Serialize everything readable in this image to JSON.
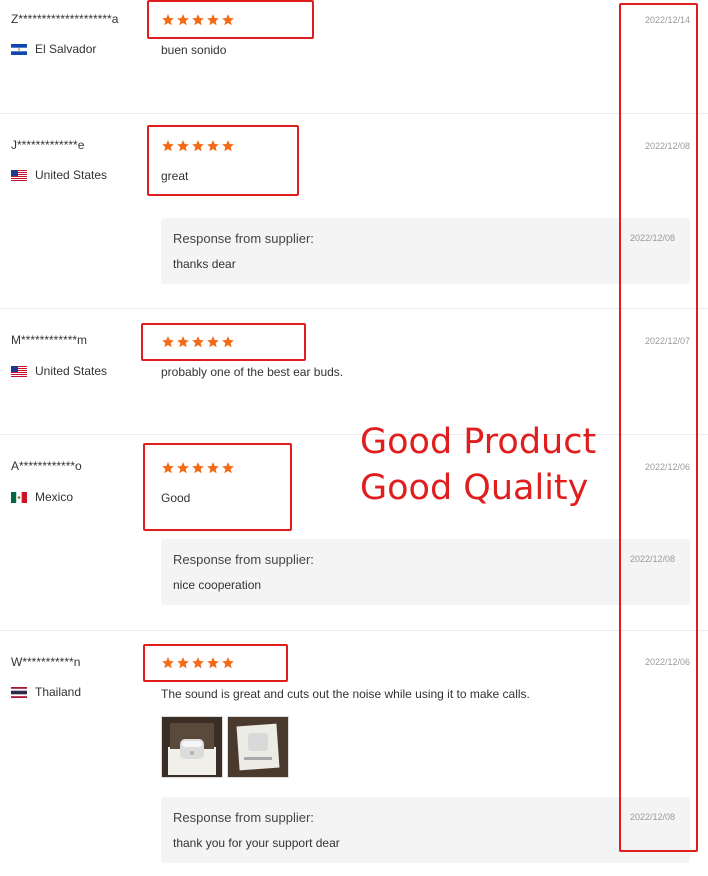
{
  "reviews": [
    {
      "name": "Z********************a",
      "country": "El Salvador",
      "flag": "el-salvador-flag-icon",
      "stars": 5,
      "text": "buen sonido",
      "date": "2022/12/14"
    },
    {
      "name": "J*************e",
      "country": "United States",
      "flag": "united-states-flag-icon",
      "stars": 5,
      "text": "great",
      "date": "2022/12/08",
      "response": {
        "title": "Response from supplier:",
        "text": "thanks dear",
        "date": "2022/12/08"
      }
    },
    {
      "name": "M************m",
      "country": "United States",
      "flag": "united-states-flag-icon",
      "stars": 5,
      "text": "probably one of the best ear buds.",
      "date": "2022/12/07"
    },
    {
      "name": "A************o",
      "country": "Mexico",
      "flag": "mexico-flag-icon",
      "stars": 5,
      "text": "Good",
      "date": "2022/12/06",
      "response": {
        "title": "Response from supplier:",
        "text": "nice cooperation",
        "date": "2022/12/08"
      }
    },
    {
      "name": "W***********n",
      "country": "Thailand",
      "flag": "thailand-flag-icon",
      "stars": 5,
      "text": "The sound is great and cuts out the noise while using it to make calls.",
      "date": "2022/12/06",
      "photos": [
        "earbuds-case-photo",
        "earbuds-box-photo"
      ],
      "response": {
        "title": "Response from supplier:",
        "text": "thank you for your support dear",
        "date": "2022/12/08"
      }
    }
  ],
  "annotation": {
    "line1": "Good Product",
    "line2": "Good Quality"
  },
  "colors": {
    "star": "#f46a17",
    "annotation": "#e01e1e",
    "response_bg": "#f4f4f4"
  }
}
